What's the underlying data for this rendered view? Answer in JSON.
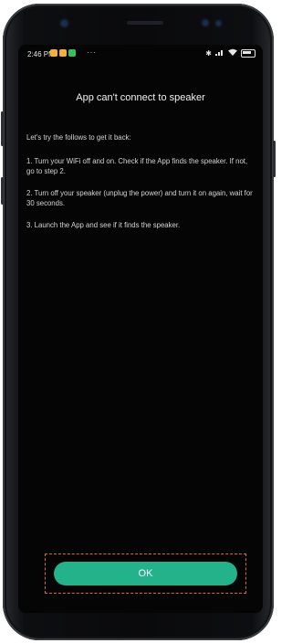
{
  "status_bar": {
    "time": "2:46 PM",
    "more_dots": "···",
    "icons": [
      "bluetooth-icon",
      "signal-icon",
      "wifi-icon",
      "battery-icon"
    ],
    "notif_colors": [
      "#f4b03a",
      "#f4b03a",
      "#3bbf5c"
    ]
  },
  "dialog": {
    "title": "App can't connect to speaker",
    "intro": "Let's try the follows to get it back:",
    "steps": [
      "1. Turn your WiFi off and on. Check if the App finds the speaker. If not, go to step 2.",
      "2. Turn off your speaker (unplug the power) and turn it on again, wait for 30 seconds.",
      "3. Launch the App and see if it finds the speaker."
    ],
    "ok_label": "OK"
  },
  "colors": {
    "accent": "#23b28a",
    "highlight_border": "#d9692e",
    "background": "#050505"
  }
}
